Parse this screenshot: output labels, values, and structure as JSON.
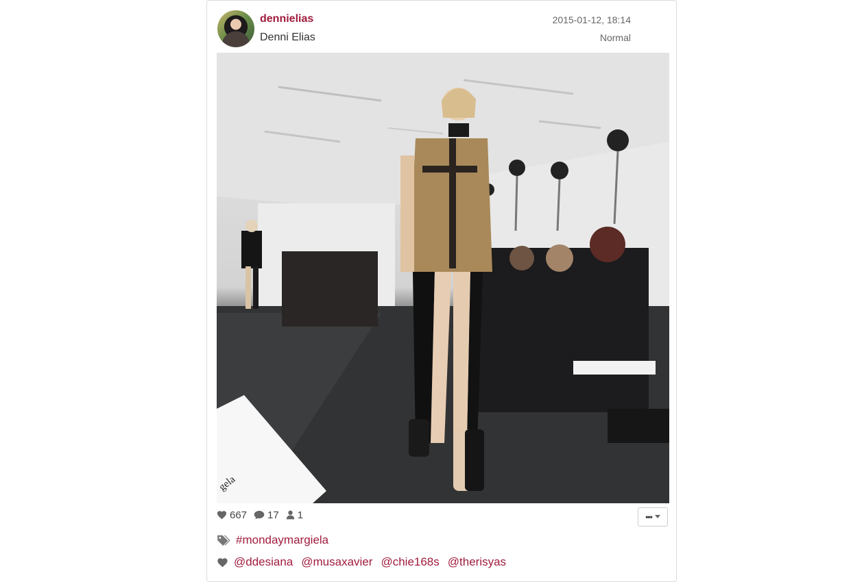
{
  "post": {
    "username": "dennielias",
    "full_name": "Denni Elias",
    "timestamp": "2015-01-12, 18:14",
    "filter": "Normal",
    "photo_icon": "runway-photo",
    "stats": {
      "likes": "667",
      "comments": "17",
      "users": "1"
    },
    "more_label": "•••",
    "hashtags": [
      "#mondaymargiela"
    ],
    "mentions": [
      "@ddesiana",
      "@musaxavier",
      "@chie168s",
      "@therisyas"
    ],
    "photo_caption_fragment": "gela"
  },
  "colors": {
    "accent": "#a11c3d",
    "muted": "#666666",
    "border": "#dcdcdc"
  },
  "icons": {
    "likes": "heart-icon",
    "comments": "comment-icon",
    "users": "user-icon",
    "tags": "tag-icon",
    "mentions": "heart-icon",
    "more": "caret-down-icon"
  }
}
